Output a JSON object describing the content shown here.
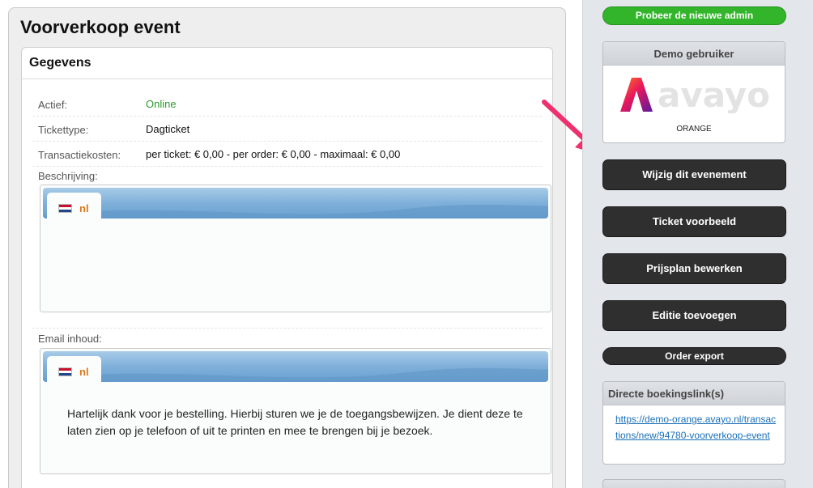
{
  "page": {
    "title": "Voorverkoop event"
  },
  "details": {
    "header": "Gegevens",
    "fields": [
      {
        "label": "Actief:",
        "value": "Online"
      },
      {
        "label": "Tickettype:",
        "value": "Dagticket"
      },
      {
        "label": "Transactiekosten:",
        "value": "per ticket: € 0,00 - per order: € 0,00 - maximaal: € 0,00"
      }
    ],
    "description": {
      "label": "Beschrijving:",
      "lang_tab": "nl",
      "content": ""
    },
    "email": {
      "label": "Email inhoud:",
      "lang_tab": "nl",
      "content": "Hartelijk dank voor je bestelling. Hierbij sturen we je de toegangsbewijzen. Je dient deze te laten zien op je telefoon of uit te printen en mee te brengen bij je bezoek."
    }
  },
  "sidebar": {
    "try_new_admin": "Probeer de nieuwe admin",
    "demo_user": {
      "title": "Demo gebruiker",
      "logo_text": "avayo",
      "organization": "ORANGE"
    },
    "actions": [
      "Wijzig dit evenement",
      "Ticket voorbeeld",
      "Prijsplan bewerken",
      "Editie toevoegen",
      "Order export"
    ],
    "booking_link": {
      "title": "Directe boekingslink(s)",
      "url": "https://demo-orange.avayo.nl/transactions/new/94780-voorverkoop-event"
    }
  },
  "colors": {
    "online": "#2a9a2a",
    "try_button": "#33b52b",
    "arrow": "#f0306e",
    "lang_code": "#d9771a",
    "dark_button": "#2f2f2f"
  },
  "icons": {
    "flag": "netherlands-flag-icon",
    "arrow": "pointer-arrow-icon"
  }
}
